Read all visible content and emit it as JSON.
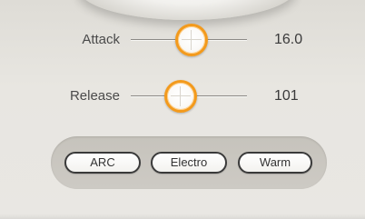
{
  "sliders": [
    {
      "label": "Attack",
      "value": "16.0",
      "position": 0.5
    },
    {
      "label": "Release",
      "value": "101",
      "position": 0.42
    }
  ],
  "presets": [
    "ARC",
    "Electro",
    "Warm"
  ],
  "colors": {
    "accent": "#f39a1c",
    "panel": "#e8e6e1",
    "preset_bar": "#c9c6bf"
  },
  "icons": [
    "thumb-crosshair-icon"
  ]
}
